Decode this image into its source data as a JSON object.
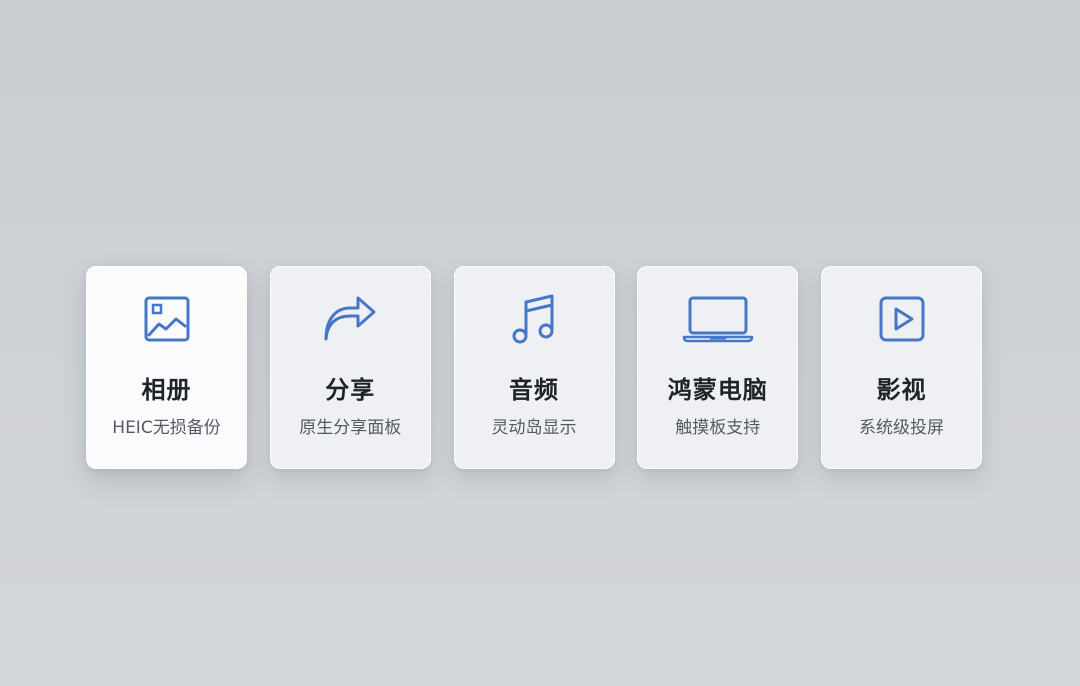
{
  "colors": {
    "accent": "#4677c6",
    "title_text": "#1f2328",
    "subtitle_text": "#555b63",
    "background": "#cdd0d4"
  },
  "cards": [
    {
      "icon": "image-icon",
      "title": "相册",
      "subtitle": "HEIC无损备份",
      "active": true
    },
    {
      "icon": "share-arrow-icon",
      "title": "分享",
      "subtitle": "原生分享面板",
      "active": false
    },
    {
      "icon": "music-note-icon",
      "title": "音频",
      "subtitle": "灵动岛显示",
      "active": false
    },
    {
      "icon": "laptop-icon",
      "title": "鸿蒙电脑",
      "subtitle": "触摸板支持",
      "active": false
    },
    {
      "icon": "play-icon",
      "title": "影视",
      "subtitle": "系统级投屏",
      "active": false
    }
  ]
}
